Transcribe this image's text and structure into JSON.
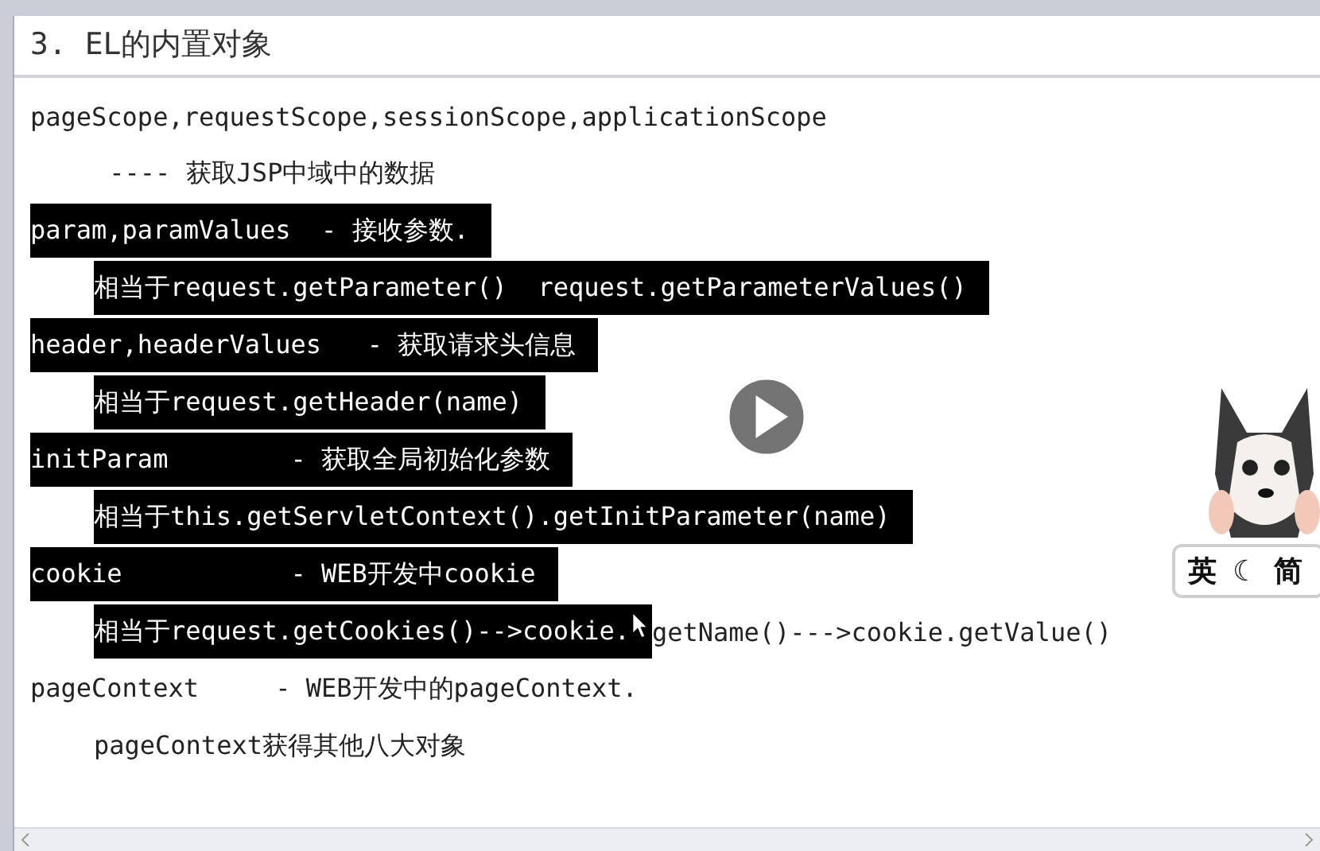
{
  "heading": "3. EL的内置对象",
  "lines": [
    {
      "indent": false,
      "segments": [
        {
          "text": "pageScope,requestScope,sessionScope,applicationScope",
          "selected": false
        }
      ]
    },
    {
      "indent": true,
      "segments": [
        {
          "text": " ---- 获取JSP中域中的数据",
          "selected": false
        }
      ]
    },
    {
      "indent": false,
      "segments": [
        {
          "text": "param,paramValues  - 接收参数.",
          "selected": true
        }
      ]
    },
    {
      "indent": true,
      "segments": [
        {
          "text": "相当于request.getParameter()  request.getParameterValues()",
          "selected": true
        }
      ]
    },
    {
      "indent": false,
      "segments": [
        {
          "text": "header,headerValues   - 获取请求头信息",
          "selected": true
        }
      ]
    },
    {
      "indent": true,
      "segments": [
        {
          "text": "相当于request.getHeader(name)",
          "selected": true
        }
      ]
    },
    {
      "indent": false,
      "segments": [
        {
          "text": "initParam        - 获取全局初始化参数",
          "selected": true
        }
      ]
    },
    {
      "indent": true,
      "segments": [
        {
          "text": "相当于this.getServletContext().getInitParameter(name)",
          "selected": true
        }
      ]
    },
    {
      "indent": false,
      "segments": [
        {
          "text": "cookie           - WEB开发中cookie",
          "selected": true
        }
      ]
    },
    {
      "indent": true,
      "segments": [
        {
          "text": "相当于request.getCookies()-->cookie.",
          "selected": true
        },
        {
          "text": "getName()--->cookie.getValue()",
          "selected": false
        }
      ]
    },
    {
      "indent": false,
      "segments": [
        {
          "text": "pageContext     - WEB开发中的pageContext.",
          "selected": false
        }
      ]
    },
    {
      "indent": true,
      "segments": [
        {
          "text": "pageContext获得其他八大对象",
          "selected": false
        }
      ]
    }
  ],
  "ime_toolbar": [
    "英",
    "☾",
    "简"
  ]
}
